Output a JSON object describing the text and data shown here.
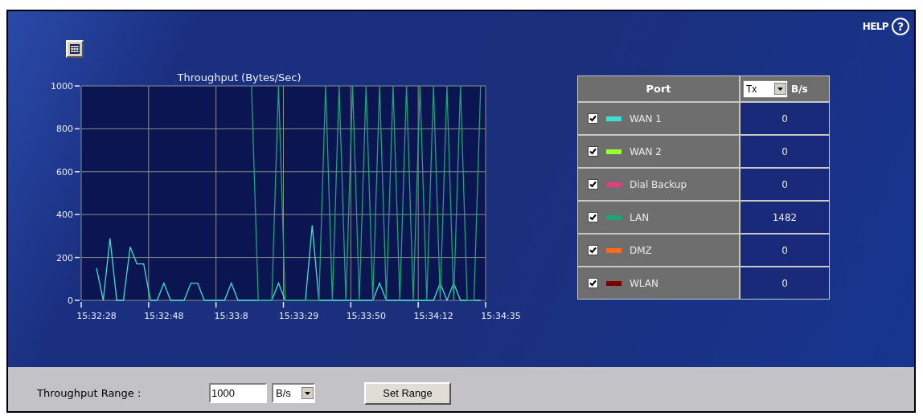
{
  "help": {
    "label": "HELP",
    "icon": "?"
  },
  "chart": {
    "chart_data": {
      "type": "line",
      "title": "Throughput (Bytes/Sec)",
      "categories": [
        "15:32:28",
        null,
        null,
        null,
        null,
        null,
        null,
        null,
        null,
        null,
        "15:32:48",
        null,
        null,
        null,
        null,
        null,
        null,
        null,
        null,
        null,
        "15:33:8",
        null,
        null,
        null,
        null,
        null,
        null,
        null,
        null,
        null,
        "15:33:29",
        null,
        null,
        null,
        null,
        null,
        null,
        null,
        null,
        null,
        "15:33:50",
        null,
        null,
        null,
        null,
        null,
        null,
        null,
        null,
        null,
        "15:34:12",
        null,
        null,
        null,
        null,
        null,
        null,
        null,
        null,
        null,
        "15:34:35"
      ],
      "ylim": [
        0,
        1000
      ],
      "grid": true,
      "yticks": [
        0,
        200,
        400,
        600,
        800,
        1000
      ],
      "series": [
        {
          "color": "#40e0d0",
          "values": [
            150,
            0,
            289,
            0,
            0,
            249,
            170,
            170,
            0,
            0,
            80,
            0,
            0,
            0,
            80,
            80,
            0,
            0,
            0,
            0,
            80,
            0,
            0,
            0,
            0,
            0,
            0,
            80,
            0,
            0,
            0,
            0,
            350,
            0,
            0,
            0,
            0,
            0,
            0,
            0,
            0,
            0,
            80,
            0,
            0,
            0,
            0,
            0,
            0,
            0,
            0,
            80,
            0,
            80,
            0,
            0,
            0,
            0,
            null,
            null,
            null
          ]
        },
        {
          "color": "#1fa37a",
          "values": [
            null,
            null,
            null,
            null,
            null,
            null,
            null,
            null,
            null,
            null,
            null,
            null,
            null,
            null,
            null,
            null,
            null,
            null,
            null,
            null,
            null,
            null,
            null,
            1000,
            0,
            0,
            0,
            1000,
            0,
            0,
            0,
            0,
            0,
            0,
            1000,
            0,
            1000,
            0,
            1000,
            0,
            1000,
            0,
            1000,
            0,
            1000,
            0,
            1000,
            0,
            1000,
            0,
            1000,
            0,
            1000,
            0,
            1000,
            0,
            0,
            1000,
            null,
            null,
            null
          ]
        }
      ]
    }
  },
  "ports_table": {
    "port_header": "Port",
    "direction": "Tx",
    "unit": "B/s",
    "rows": [
      {
        "checked": true,
        "color": "#40e0d0",
        "name": "WAN 1",
        "value": "0"
      },
      {
        "checked": true,
        "color": "#99ff33",
        "name": "WAN 2",
        "value": "0"
      },
      {
        "checked": true,
        "color": "#e0407a",
        "name": "Dial Backup",
        "value": "0"
      },
      {
        "checked": true,
        "color": "#1fa37a",
        "name": "LAN",
        "value": "1482"
      },
      {
        "checked": true,
        "color": "#ff6a1a",
        "name": "DMZ",
        "value": "0"
      },
      {
        "checked": true,
        "color": "#7a0000",
        "name": "WLAN",
        "value": "0"
      }
    ]
  },
  "range_bar": {
    "label": "Throughput Range :",
    "value": "1000",
    "unit": "B/s",
    "button": "Set Range"
  }
}
